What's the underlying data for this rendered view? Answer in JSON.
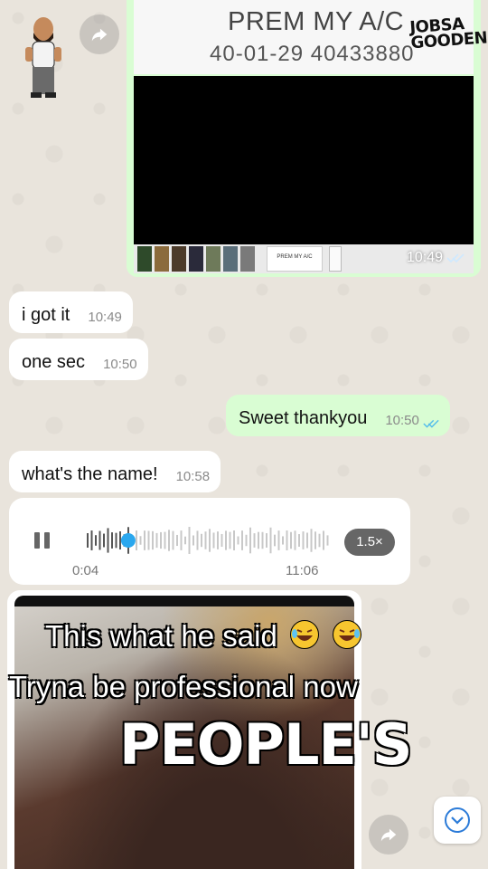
{
  "logo_text": [
    "JOBSA",
    "GOODEN"
  ],
  "shared_image": {
    "title": "PREM MY A/C",
    "subtitle": "40-01-29 40433880",
    "thumb_caption": "PREM MY A/C",
    "time": "10:49",
    "status": "read"
  },
  "messages": [
    {
      "direction": "incoming",
      "text": "i got it",
      "time": "10:49"
    },
    {
      "direction": "incoming",
      "text": "one sec",
      "time": "10:50"
    },
    {
      "direction": "outgoing",
      "text": "Sweet thankyou",
      "time": "10:50",
      "status": "read"
    },
    {
      "direction": "incoming",
      "text": "what's the name!",
      "time": "10:58"
    }
  ],
  "voice_note": {
    "elapsed": "0:04",
    "sent_time": "11:06",
    "speed": "1.5×",
    "progress": 0.17
  },
  "overlay": {
    "line1": "This what he said",
    "line2": "Tryna be professional now",
    "line3": "PEOPLE'S"
  },
  "colors": {
    "incoming_bubble": "#ffffff",
    "outgoing_bubble": "#d9fdd3",
    "read_ticks": "#53bdeb",
    "voice_progress": "#2aa7ee"
  },
  "icons": {
    "forward": "forward-arrow-icon",
    "scroll_down": "chevron-down-icon",
    "pause": "pause-icon",
    "ticks": "double-check-icon"
  }
}
